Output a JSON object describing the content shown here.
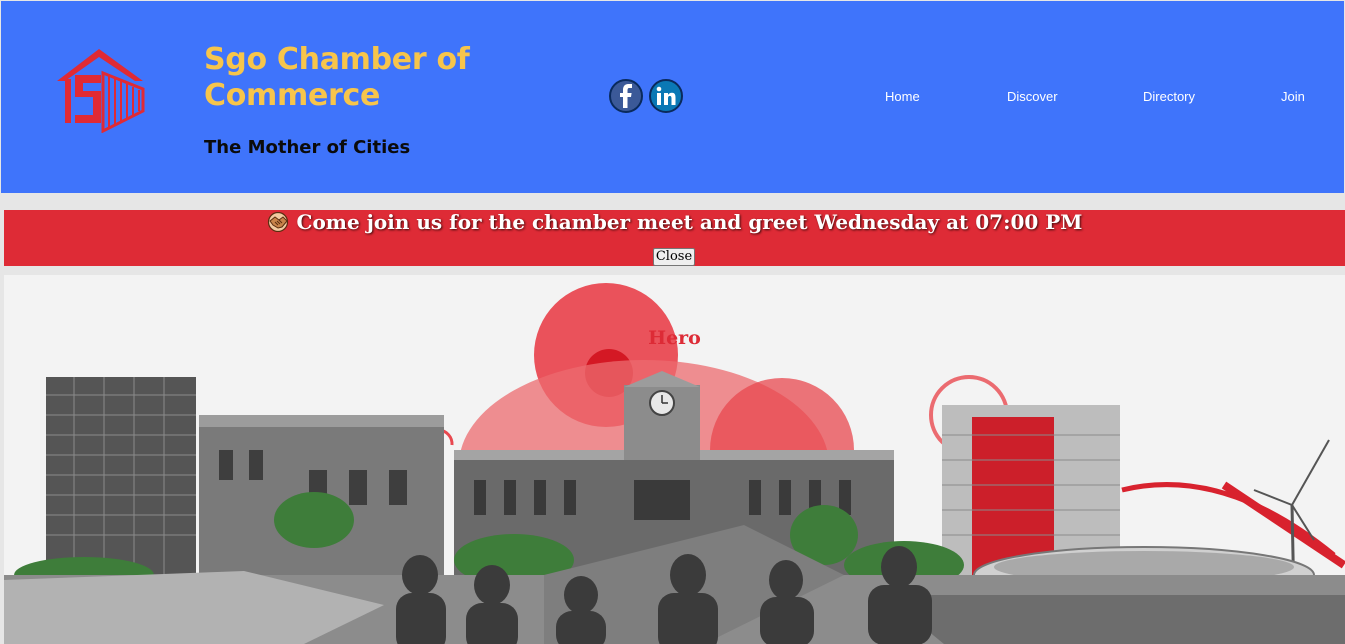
{
  "header": {
    "brand_title": "Sgo Chamber of Commerce",
    "tagline": "The Mother of Cities",
    "logo_icon": "house-s-logo-icon",
    "social": [
      {
        "icon": "facebook-icon"
      },
      {
        "icon": "linkedin-icon"
      }
    ],
    "nav": {
      "home": "Home",
      "discover": "Discover",
      "directory": "Directory",
      "join": "Join"
    }
  },
  "banner": {
    "icon": "handshake-icon",
    "message": "Come join us for the chamber meet and greet Wednesday at 07:00 PM",
    "close_label": "Close"
  },
  "hero": {
    "label": "Hero"
  },
  "colors": {
    "header_bg": "#3f74fb",
    "brand_title": "#f7c54b",
    "banner_bg": "#de2b36",
    "accent_red": "#dd2b36"
  }
}
